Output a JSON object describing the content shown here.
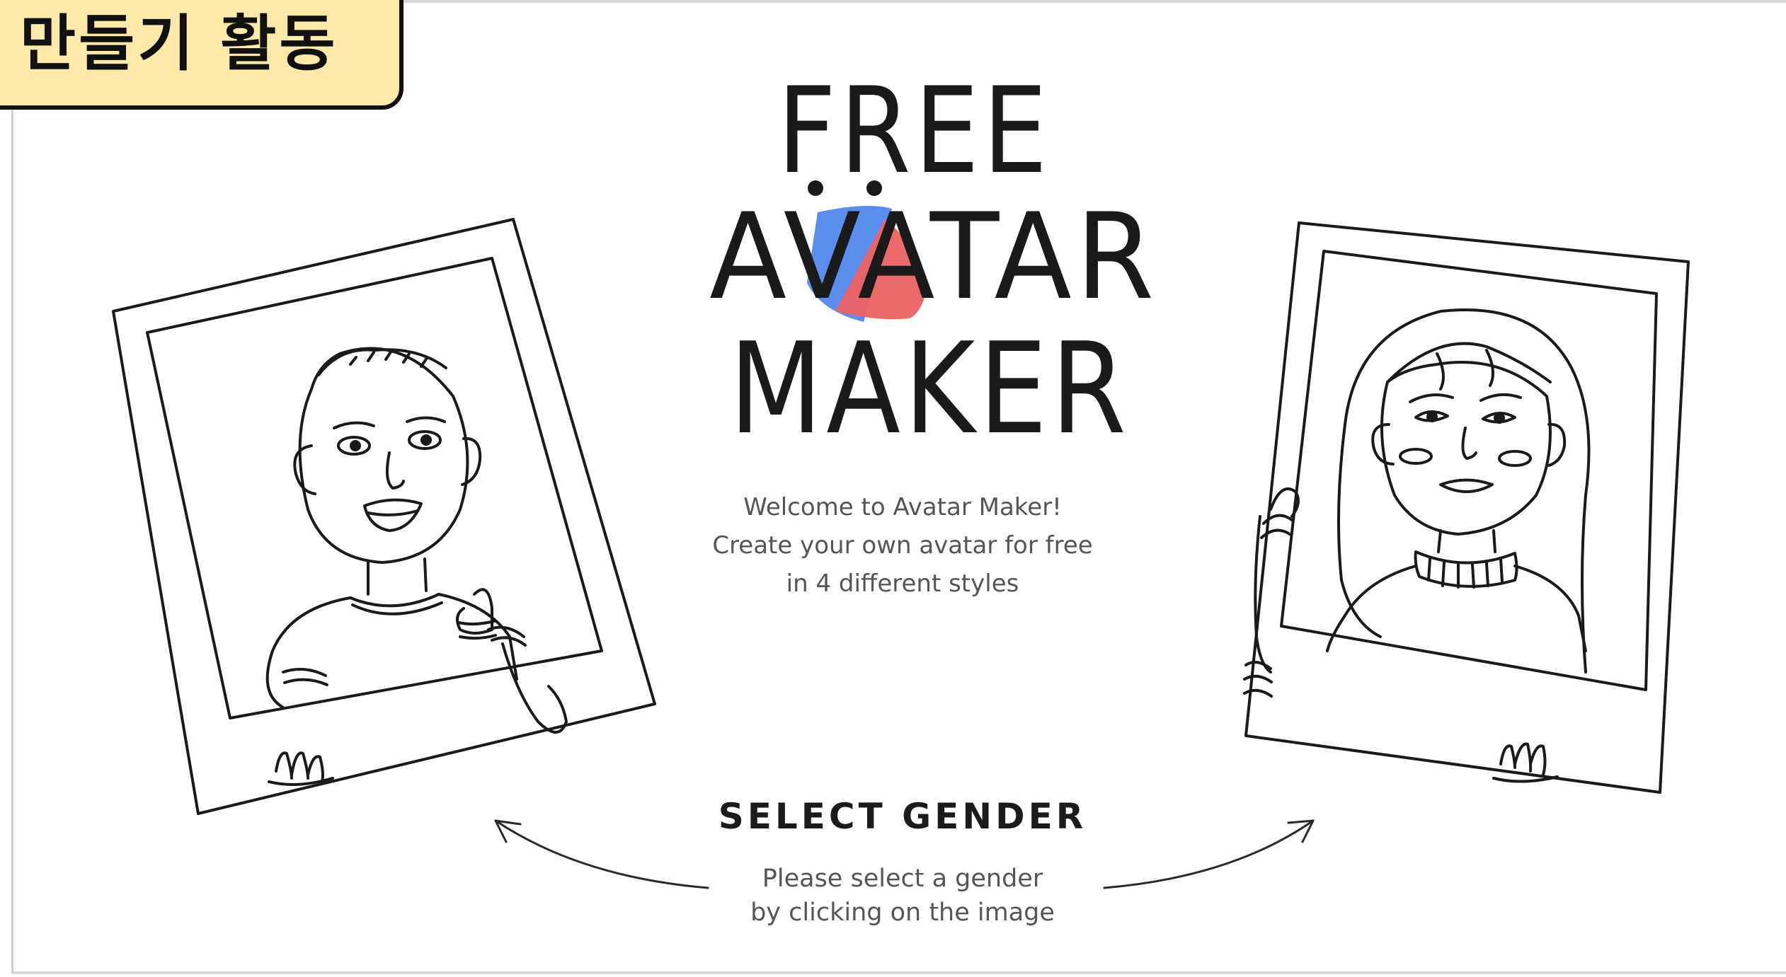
{
  "badge": {
    "label": "만들기 활동"
  },
  "logo": {
    "line1": "FREE",
    "line2": "AVATAR",
    "line3": "MAKER",
    "colors": {
      "blue": "#5b8def",
      "red": "#ec6262",
      "ink": "#1a1a1a"
    }
  },
  "welcome": {
    "line1": "Welcome to Avatar Maker!",
    "line2": "Create your own avatar for free",
    "line3": "in 4 different styles"
  },
  "gender": {
    "heading": "SELECT GENDER",
    "sub_line1": "Please select a gender",
    "sub_line2": "by clicking on the image",
    "options": [
      {
        "icon": "boy-sketch-icon"
      },
      {
        "icon": "girl-sketch-icon"
      }
    ]
  }
}
